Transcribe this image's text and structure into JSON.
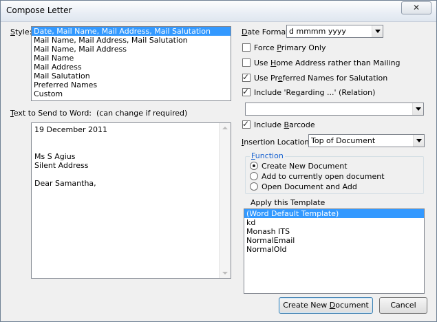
{
  "window": {
    "title": "Compose Letter",
    "close_label": "✕"
  },
  "style": {
    "label_first": "S",
    "label_rest": "tyle:",
    "items": [
      "Date, Mail Name, Mail Address, Mail Salutation",
      "Mail Name, Mail Address, Mail Salutation",
      "Mail Name, Mail Address",
      "Mail Name",
      "Mail Address",
      "Mail Salutation",
      "Preferred Names",
      "Custom"
    ],
    "selected_index": 0
  },
  "text_to_send": {
    "label_first": "T",
    "label_rest": "ext to Send to Word:",
    "hint": "(can change if required)",
    "lines": [
      "19 December 2011",
      "",
      "",
      "Ms S Agius",
      "Silent Address",
      "",
      "Dear Samantha,"
    ]
  },
  "date_format": {
    "label_first": "D",
    "label_rest": "ate Format:",
    "value": "d mmmm yyyy"
  },
  "options": {
    "force_primary": {
      "pre": "Force ",
      "u": "P",
      "post": "rimary Only",
      "checked": false
    },
    "home_address": {
      "pre": "Use ",
      "u": "H",
      "post": "ome Address rather than Mailing",
      "checked": false
    },
    "preferred_names": {
      "pre": "Use Pr",
      "u": "e",
      "post": "ferred Names for Salutation",
      "checked": true
    },
    "regarding": {
      "pre": "Include 'Re",
      "u": "g",
      "post": "arding ...' (Relation)",
      "checked": true
    },
    "relation_value": "",
    "barcode": {
      "pre": "Include ",
      "u": "B",
      "post": "arcode",
      "checked": true
    }
  },
  "insertion": {
    "label_first": "I",
    "label_rest": "nsertion Location",
    "value": "Top of Document"
  },
  "function": {
    "legend_first": "F",
    "legend_rest": "unction",
    "options": [
      {
        "label": "Create New Document",
        "selected": true
      },
      {
        "label": "Add to currently open document",
        "selected": false
      },
      {
        "label": "Open Document and Add",
        "selected": false
      }
    ]
  },
  "template": {
    "label": "Apply this Template",
    "items": [
      "(Word Default Template)",
      "kd",
      "Monash ITS",
      "NormalEmail",
      "NormalOld"
    ],
    "selected_index": 0
  },
  "buttons": {
    "create_pre": "Create New ",
    "create_u": "D",
    "create_post": "ocument",
    "cancel": "Cancel"
  },
  "colors": {
    "selection": "#3399ff",
    "legend": "#1560d0"
  }
}
